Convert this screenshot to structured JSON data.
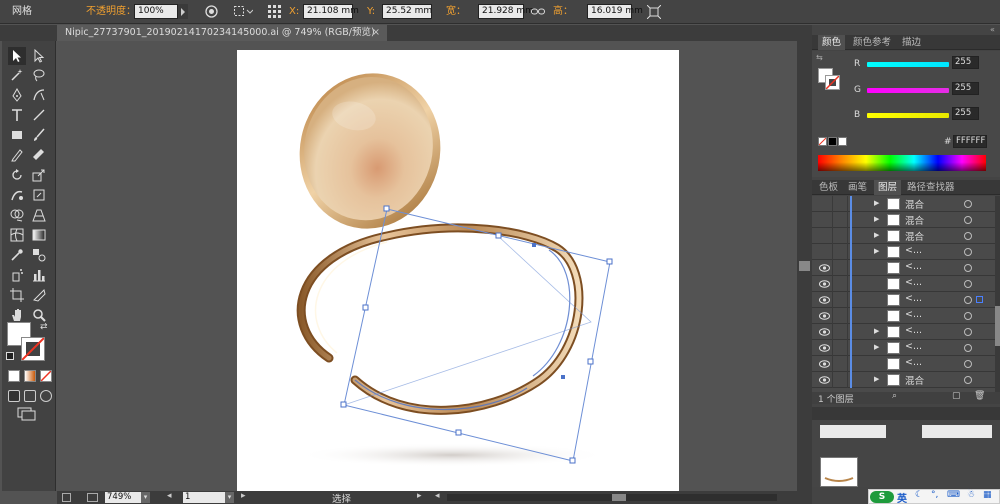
{
  "control_bar": {
    "mode_label": "网格",
    "opacity_label": "不透明度：",
    "opacity_value": "100%",
    "x_label": "X:",
    "x_value": "21.108 mm",
    "y_label": "Y:",
    "y_value": "25.52 mm",
    "w_label": "宽：",
    "w_value": "21.928 mm",
    "h_label": "高：",
    "h_value": "16.019 mm",
    "accent_color": "#f0a030"
  },
  "document": {
    "tab_title": "Nipic_27737901_20190214170234145000.ai @ 749% (RGB/预览)",
    "close_glyph": "×"
  },
  "status_bar": {
    "zoom": "749%",
    "page": "1",
    "tool_name": "选择"
  },
  "color_panel": {
    "tabs": [
      "颜色",
      "颜色参考",
      "描边"
    ],
    "active_tab": "颜色",
    "channels": [
      {
        "label": "R",
        "value": "255",
        "color": "#00e5ff"
      },
      {
        "label": "G",
        "value": "255",
        "color": "#e52ee5"
      },
      {
        "label": "B",
        "value": "255",
        "color": "#e8e800"
      }
    ],
    "hex_prefix": "#",
    "hex_value": "FFFFFF"
  },
  "layers_panel": {
    "tabs": [
      "色板",
      "画笔",
      "图层",
      "路径查找器"
    ],
    "active_tab": "图层",
    "rows": [
      {
        "name": "混合",
        "visible": false,
        "expandable": true
      },
      {
        "name": "混合",
        "visible": false,
        "expandable": true
      },
      {
        "name": "混合",
        "visible": false,
        "expandable": true
      },
      {
        "name": "<...",
        "visible": false,
        "expandable": true
      },
      {
        "name": "<...",
        "visible": true,
        "expandable": false
      },
      {
        "name": "<...",
        "visible": true,
        "expandable": false
      },
      {
        "name": "<...",
        "visible": true,
        "expandable": false
      },
      {
        "name": "<...",
        "visible": true,
        "expandable": false
      },
      {
        "name": "<...",
        "visible": true,
        "expandable": true
      },
      {
        "name": "<...",
        "visible": true,
        "expandable": true
      },
      {
        "name": "<...",
        "visible": true,
        "expandable": false
      },
      {
        "name": "混合",
        "visible": true,
        "expandable": true
      }
    ],
    "footer_text": "1 个图层"
  },
  "taskbar": {
    "ime_label": "英"
  }
}
